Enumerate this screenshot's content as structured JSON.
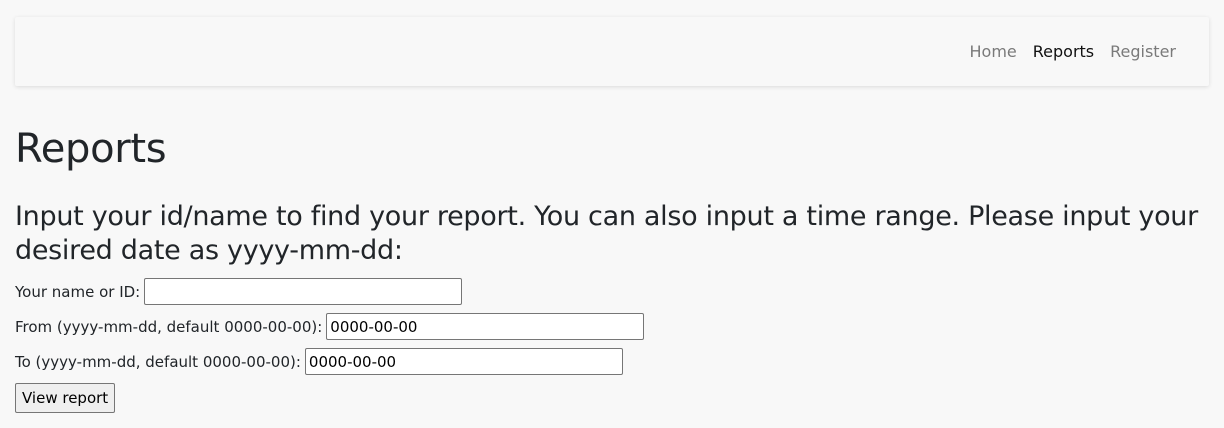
{
  "nav": {
    "items": [
      {
        "label": "Home",
        "active": false
      },
      {
        "label": "Reports",
        "active": true
      },
      {
        "label": "Register",
        "active": false
      }
    ]
  },
  "page": {
    "title": "Reports",
    "instructions": "Input your id/name to find your report. You can also input a time range. Please input your desired date as yyyy-mm-dd:"
  },
  "form": {
    "name_label": "Your name or ID:",
    "name_value": "",
    "from_label": "From (yyyy-mm-dd, default 0000-00-00):",
    "from_value": "0000-00-00",
    "to_label": "To (yyyy-mm-dd, default 0000-00-00):",
    "to_value": "0000-00-00",
    "submit_label": "View report"
  }
}
